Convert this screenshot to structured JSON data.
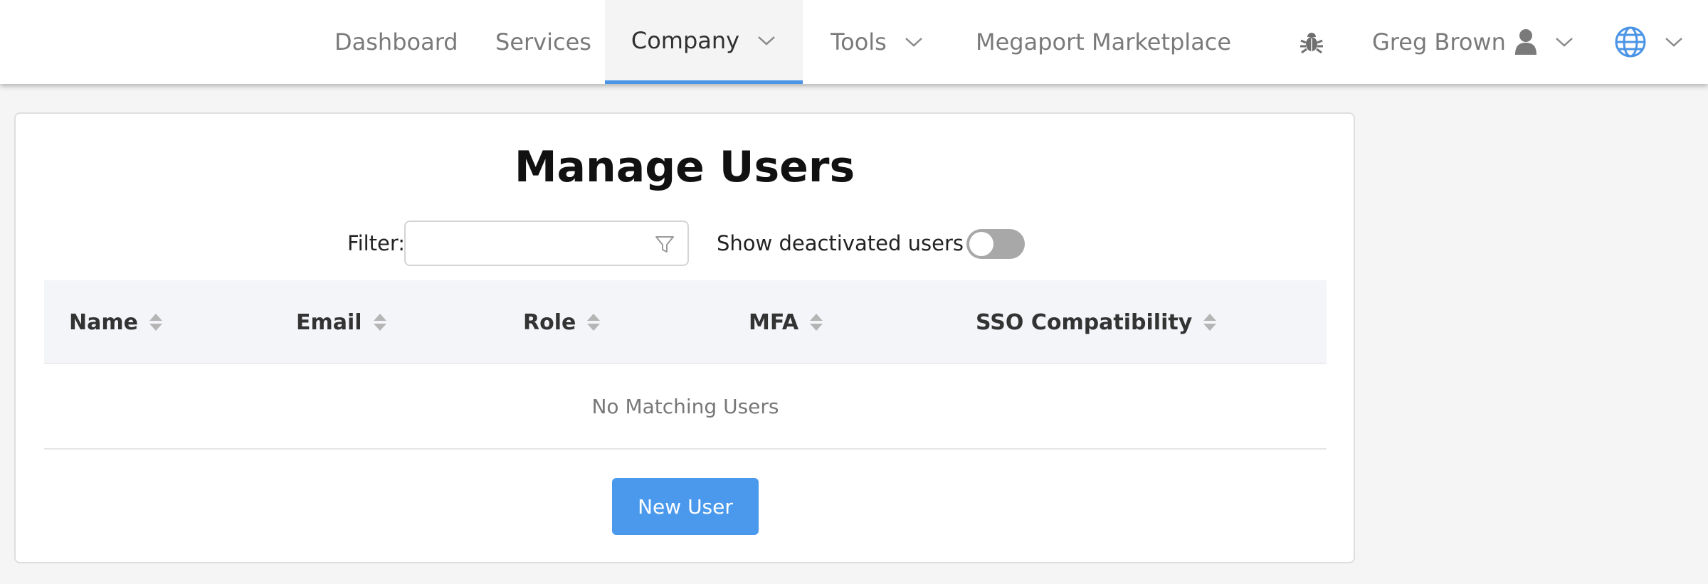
{
  "nav": {
    "dashboard": "Dashboard",
    "services": "Services",
    "company": "Company",
    "tools": "Tools",
    "marketplace": "Megaport Marketplace",
    "user_name": "Greg Brown"
  },
  "colors": {
    "accent": "#4a94e6",
    "button": "#4a99ec",
    "table_header_bg": "#f4f5f9"
  },
  "icons": [
    "chevron-down-icon",
    "bug-icon",
    "user-icon",
    "globe-icon",
    "funnel-icon",
    "sort-icon"
  ],
  "page": {
    "title": "Manage Users",
    "filter_label": "Filter:",
    "filter_value": "",
    "filter_placeholder": "",
    "show_deactivated_label": "Show deactivated users",
    "show_deactivated_on": false
  },
  "table": {
    "columns": [
      "Name",
      "Email",
      "Role",
      "MFA",
      "SSO Compatibility"
    ],
    "empty_message": "No Matching Users"
  },
  "actions": {
    "new_user": "New User"
  }
}
